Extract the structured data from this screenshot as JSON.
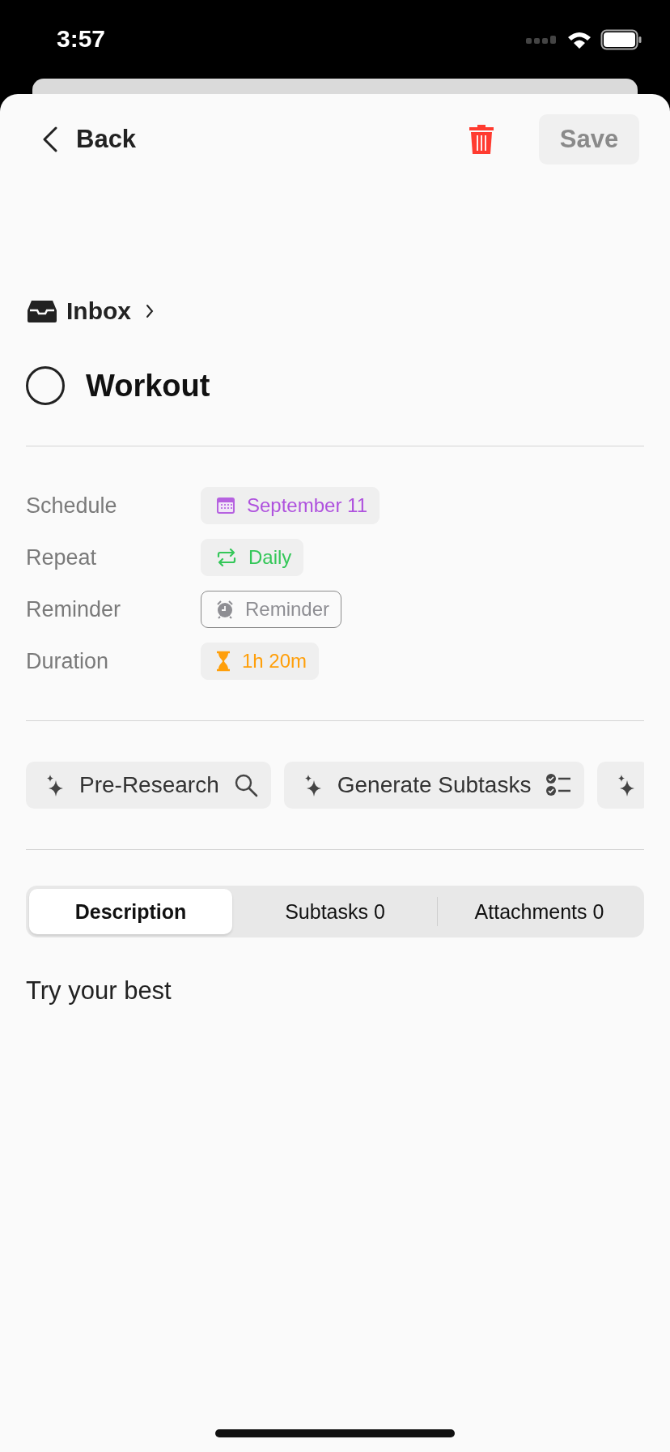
{
  "status_bar": {
    "time": "3:57"
  },
  "header": {
    "back_label": "Back",
    "save_label": "Save",
    "save_disabled": true
  },
  "breadcrumb": {
    "project": "Inbox"
  },
  "task": {
    "title": "Workout",
    "completed": false
  },
  "properties": [
    {
      "label": "Schedule",
      "kind": "date",
      "value": "September 11",
      "set": true,
      "color": "#af52de"
    },
    {
      "label": "Repeat",
      "kind": "repeat",
      "value": "Daily",
      "set": true,
      "color": "#34c759"
    },
    {
      "label": "Reminder",
      "kind": "reminder",
      "value": "Reminder",
      "set": false,
      "color": "#8e8e93"
    },
    {
      "label": "Duration",
      "kind": "duration",
      "value": "1h 20m",
      "set": true,
      "color": "#ff9f0a"
    }
  ],
  "ai_actions": [
    {
      "label": "Pre-Research",
      "kind": "search"
    },
    {
      "label": "Generate Subtasks",
      "kind": "checklist"
    },
    {
      "kind": "plain"
    }
  ],
  "tabs": [
    {
      "label": "Description",
      "selected": true
    },
    {
      "label": "Subtasks 0",
      "selected": false
    },
    {
      "label": "Attachments 0",
      "selected": false
    }
  ],
  "description": "Try your best"
}
